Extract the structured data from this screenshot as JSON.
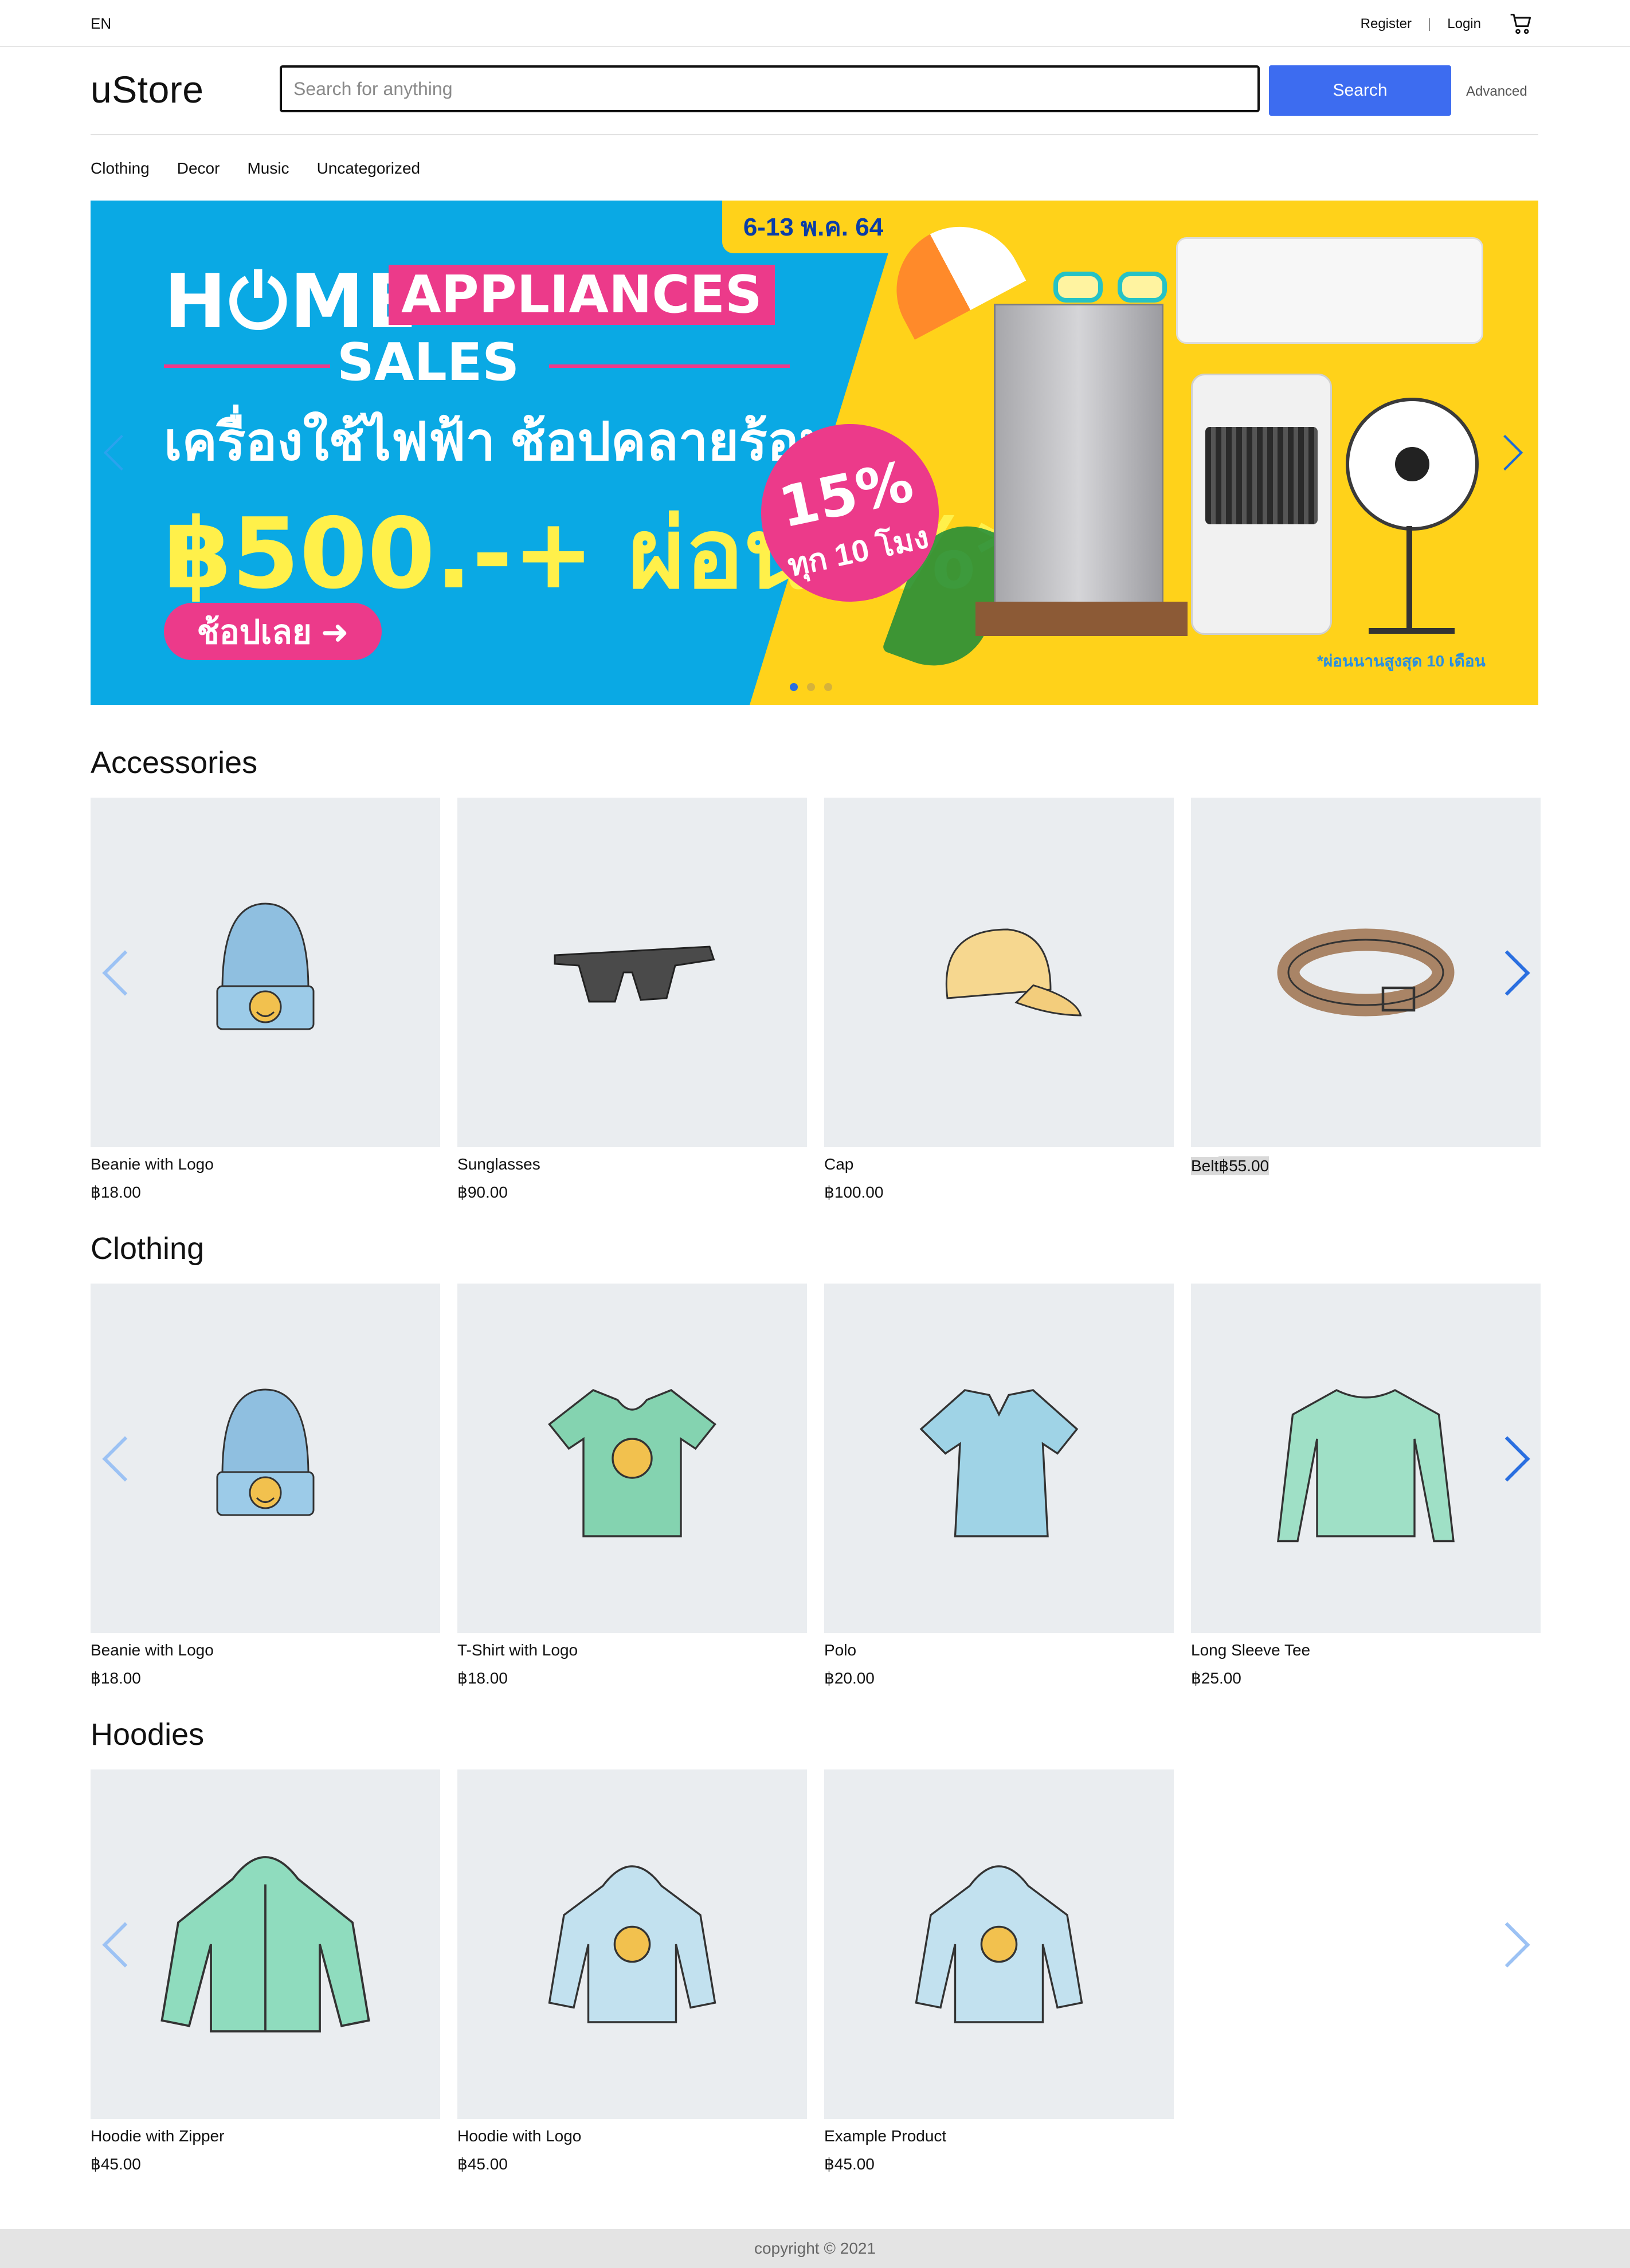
{
  "topbar": {
    "lang": "EN",
    "register": "Register",
    "separator": "|",
    "login": "Login",
    "cart_icon": "cart-icon"
  },
  "header": {
    "logo": "uStore",
    "search_placeholder": "Search for anything",
    "search_button": "Search",
    "advanced": "Advanced"
  },
  "nav": [
    "Clothing",
    "Decor",
    "Music",
    "Uncategorized"
  ],
  "banner": {
    "date": "6-13 พ.ค. 64",
    "home": "H⏻ME",
    "appliances": "APPLIANCES",
    "sales": "SALES",
    "thai_line": "เครื่องใช้ไฟฟ้า ช้อปคลายร้อน",
    "offer": "฿500.-+ ผ่อน0%*",
    "cta": "ช้อปเลย ➜",
    "flash_pct": "15%",
    "flash_sub": "ทุก 10 โมง",
    "note": "*ผ่อนนานสูงสุด 10 เดือน",
    "active_slide": 0,
    "slides": 3,
    "colors": {
      "left_bg": "#0aa9e4",
      "right_bg": "#ffd21a",
      "pink": "#ec3a8a"
    }
  },
  "sections": [
    {
      "title": "Accessories",
      "products": [
        {
          "name": "Beanie with Logo",
          "price": "฿18.00",
          "icon": "beanie",
          "highlight": false
        },
        {
          "name": "Sunglasses",
          "price": "฿90.00",
          "icon": "sunglasses",
          "highlight": false
        },
        {
          "name": "Cap",
          "price": "฿100.00",
          "icon": "cap",
          "highlight": false
        },
        {
          "name": "Belt",
          "price": "฿55.00",
          "icon": "belt",
          "highlight": true
        }
      ]
    },
    {
      "title": "Clothing",
      "products": [
        {
          "name": "Beanie with Logo",
          "price": "฿18.00",
          "icon": "beanie"
        },
        {
          "name": "T-Shirt with Logo",
          "price": "฿18.00",
          "icon": "tshirt"
        },
        {
          "name": "Polo",
          "price": "฿20.00",
          "icon": "polo"
        },
        {
          "name": "Long Sleeve Tee",
          "price": "฿25.00",
          "icon": "longsleeve"
        }
      ]
    },
    {
      "title": "Hoodies",
      "products": [
        {
          "name": "Hoodie with Zipper",
          "price": "฿45.00",
          "icon": "hoodie-zipper"
        },
        {
          "name": "Hoodie with Logo",
          "price": "฿45.00",
          "icon": "hoodie-logo"
        },
        {
          "name": "Example Product",
          "price": "฿45.00",
          "icon": "hoodie-logo"
        }
      ]
    }
  ],
  "footer": "copyright © 2021",
  "colors": {
    "accent": "#3d6cf0",
    "card_bg": "#eaedf0",
    "arrow_active": "#2a6fe0",
    "arrow_faint": "#9cc2f4"
  }
}
